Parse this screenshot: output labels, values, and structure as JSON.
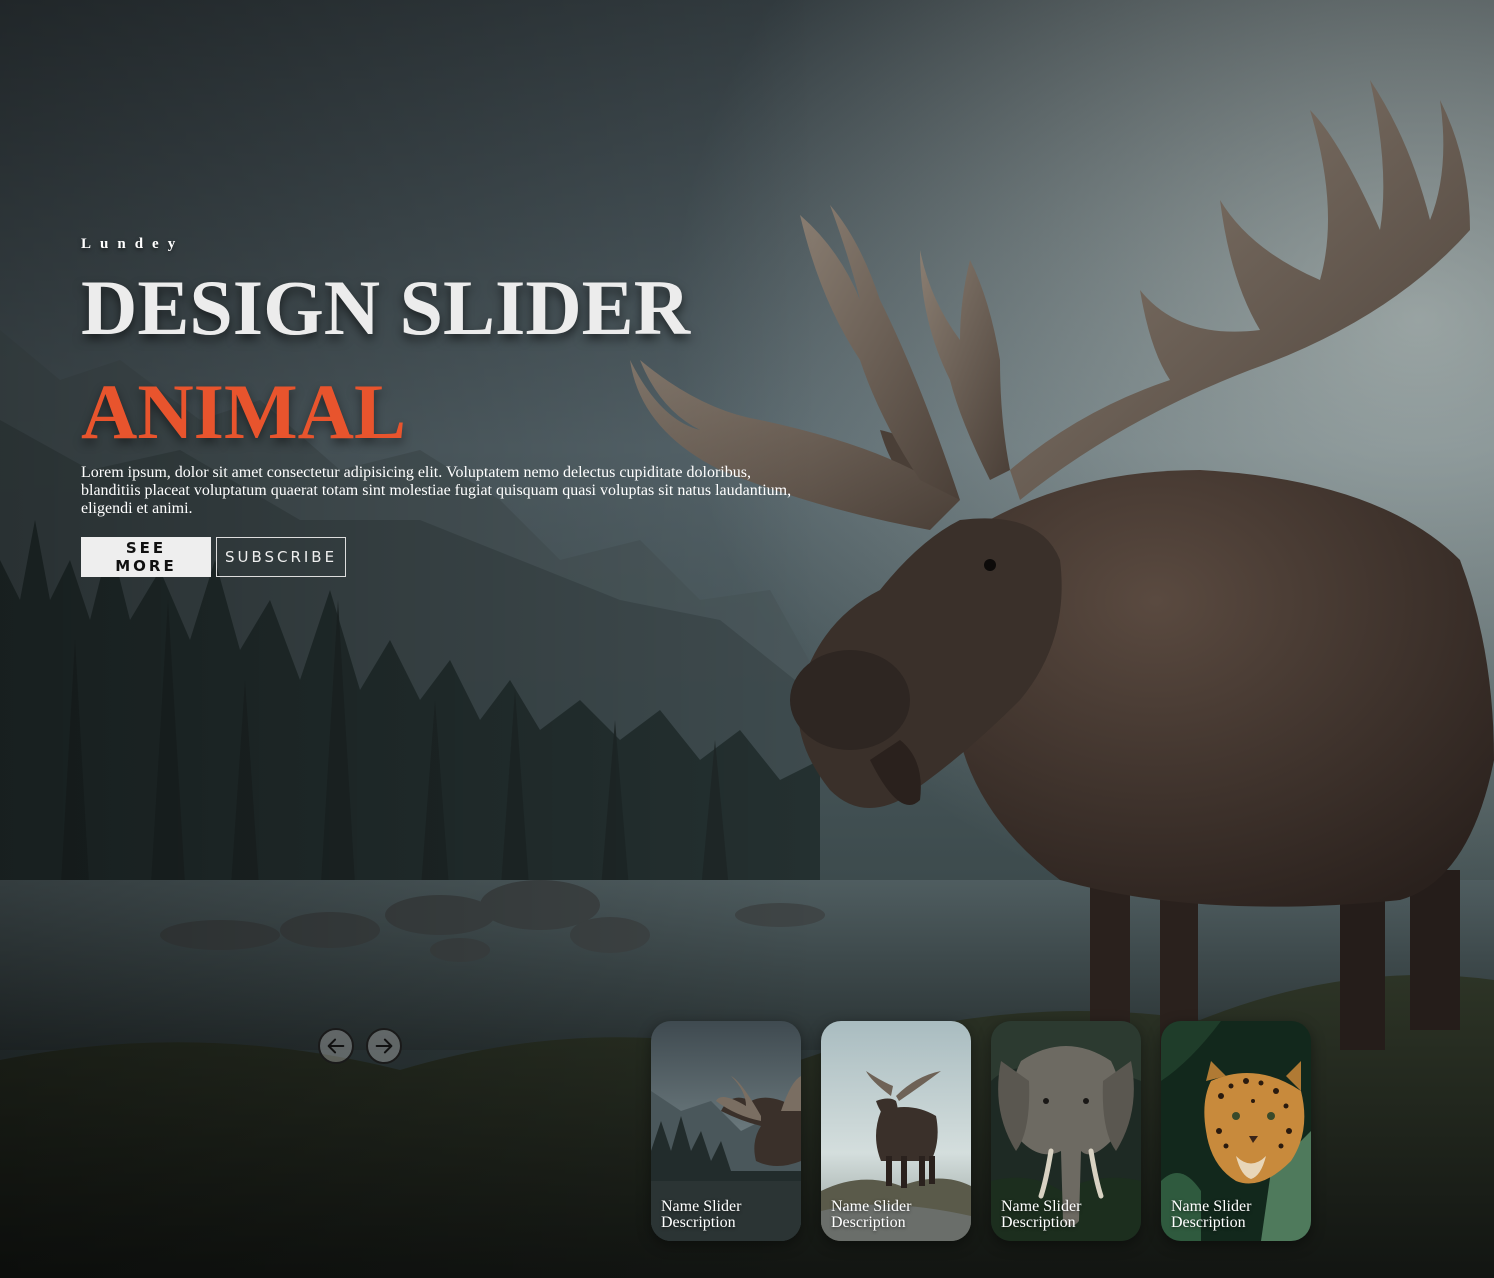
{
  "hero": {
    "author": "Lundey",
    "title": "DESIGN SLIDER",
    "topic": "ANIMAL",
    "description": "Lorem ipsum, dolor sit amet consectetur adipisicing elit. Voluptatem nemo delectus cupiditate doloribus, blanditiis placeat voluptatum quaerat totam sint molestiae fugiat quisquam quasi voluptas sit natus laudantium, eligendi et animi.",
    "see_more_label": "SEE MORE",
    "subscribe_label": "SUBSCRIBE",
    "background_subject": "moose"
  },
  "navigation": {
    "prev_icon": "arrow-left-icon",
    "next_icon": "arrow-right-icon"
  },
  "thumbnails": [
    {
      "subject": "moose",
      "title": "Name Slider",
      "description": "Description"
    },
    {
      "subject": "moose",
      "title": "Name Slider",
      "description": "Description"
    },
    {
      "subject": "elephant",
      "title": "Name Slider",
      "description": "Description"
    },
    {
      "subject": "leopard",
      "title": "Name Slider",
      "description": "Description"
    }
  ],
  "colors": {
    "accent": "#e8542d",
    "title": "#ececec",
    "button_primary_bg": "#eeeeee"
  }
}
